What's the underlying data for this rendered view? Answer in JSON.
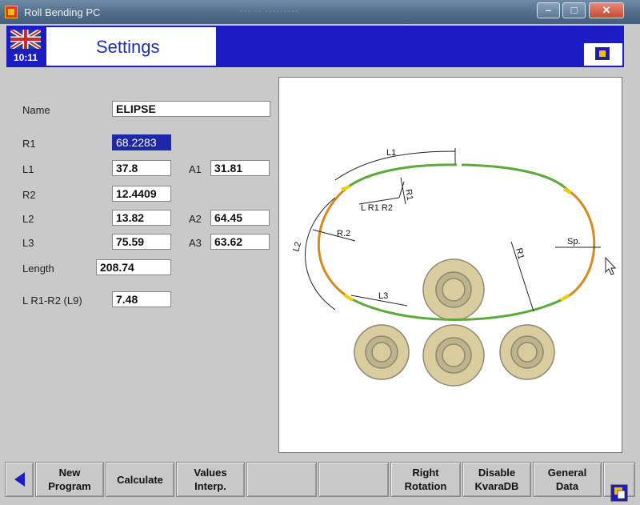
{
  "window": {
    "title": "Roll Bending PC",
    "ghost_title": "··· ·· ·········",
    "minimize": "–",
    "maximize": "□",
    "close": "✕"
  },
  "header": {
    "clock": "10:11",
    "page_title": "Settings",
    "brand_color": "#1c1cc4"
  },
  "form": {
    "name_label": "Name",
    "name_value": "ELIPSE",
    "r1_label": "R1",
    "r1_value": "68.2283",
    "l1_label": "L1",
    "l1_value": "37.8",
    "a1_label": "A1",
    "a1_value": "31.81",
    "r2_label": "R2",
    "r2_value": "12.4409",
    "l2_label": "L2",
    "l2_value": "13.82",
    "a2_label": "A2",
    "a2_value": "64.45",
    "l3_label": "L3",
    "l3_value": "75.59",
    "a3_label": "A3",
    "a3_value": "63.62",
    "length_label": "Length",
    "length_value": "208.74",
    "lr1r2_label": "L R1-R2 (L9)",
    "lr1r2_value": "7.48"
  },
  "drawing": {
    "labels": {
      "l1": "L1",
      "r1_top": "R1",
      "lr1r2": "L R1 R2",
      "r2": "R.2",
      "l2": "L2",
      "l3": "L3",
      "r1_right": "R1",
      "sp": "Sp."
    },
    "colors": {
      "straight": "#5aab3a",
      "arc": "#d98a1e",
      "roller": "#d9cc9e",
      "roller_ring": "#8e8870"
    }
  },
  "toolbar": {
    "back_icon": "back-arrow-icon",
    "new_program": "New\nProgram",
    "calculate": "Calculate",
    "values_interp": "Values\nInterp.",
    "right_rotation": "Right\nRotation",
    "disable_kvaradb": "Disable\nKvaraDB",
    "general_data": "General\nData",
    "help_icon": "help-icon"
  }
}
